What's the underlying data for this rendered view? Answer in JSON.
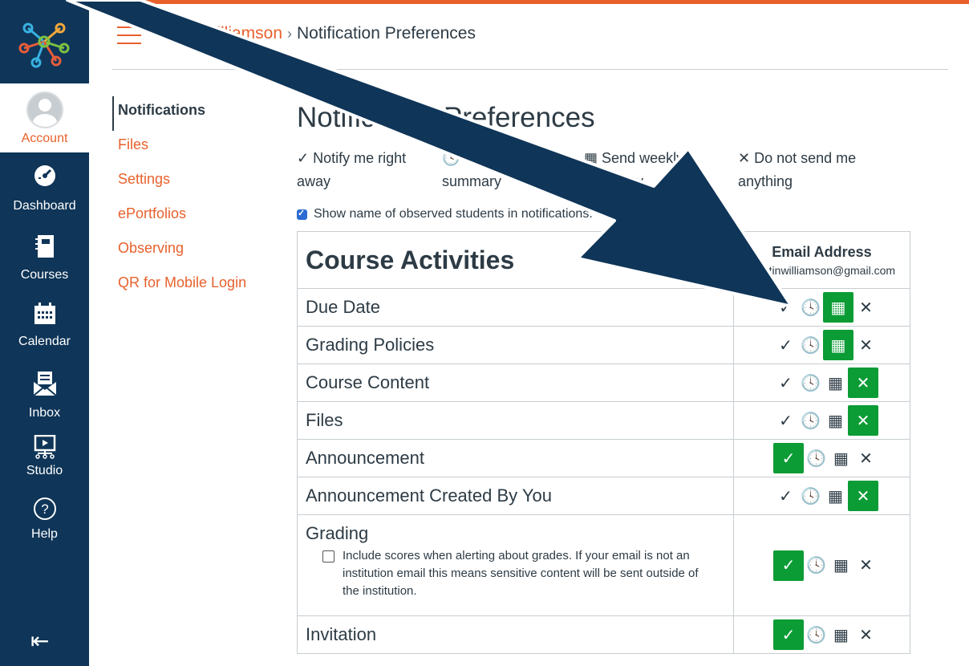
{
  "global_nav": {
    "items": [
      {
        "label": "Account",
        "icon": "user-avatar-icon"
      },
      {
        "label": "Dashboard",
        "icon": "dashboard-gauge-icon"
      },
      {
        "label": "Courses",
        "icon": "courses-book-icon"
      },
      {
        "label": "Calendar",
        "icon": "calendar-icon"
      },
      {
        "label": "Inbox",
        "icon": "inbox-envelope-icon"
      },
      {
        "label": "Studio",
        "icon": "studio-screen-icon"
      },
      {
        "label": "Help",
        "icon": "help-question-icon"
      }
    ],
    "collapse_icon": "⇤"
  },
  "header": {
    "breadcrumb_user": "Jerry Williamson",
    "breadcrumb_sep": "›",
    "breadcrumb_page": "Notification Preferences"
  },
  "section_nav": {
    "items": [
      "Notifications",
      "Files",
      "Settings",
      "ePortfolios",
      "Observing",
      "QR for Mobile Login"
    ]
  },
  "page": {
    "title": "Notification Preferences",
    "legend": [
      {
        "icon": "✓",
        "text": "Notify me right away"
      },
      {
        "icon": "🕓",
        "text": "Send daily summary"
      },
      {
        "icon": "▦",
        "text": "Send weekly summary"
      },
      {
        "icon": "✕",
        "text": "Do not send me anything"
      }
    ],
    "show_observed_label": "Show name of observed students in notifications."
  },
  "table": {
    "heading": "Course Activities",
    "email_header": "Email Address",
    "email_address": "jaustinwilliamson@gmail.com",
    "rows": [
      {
        "name": "Due Date",
        "selected": "weekly"
      },
      {
        "name": "Grading Policies",
        "selected": "weekly"
      },
      {
        "name": "Course Content",
        "selected": "never"
      },
      {
        "name": "Files",
        "selected": "never"
      },
      {
        "name": "Announcement",
        "selected": "immediately"
      },
      {
        "name": "Announcement Created By You",
        "selected": "never"
      },
      {
        "name": "Grading",
        "selected": "immediately",
        "sub": "Include scores when alerting about grades. If your email is not an institution email this means sensitive content will be sent outside of the institution."
      },
      {
        "name": "Invitation",
        "selected": "immediately"
      }
    ]
  },
  "colors": {
    "nav_bg": "#0f3558",
    "accent": "#e8612c",
    "selected_green": "#0b9c35",
    "arrow": "#0f3558"
  }
}
